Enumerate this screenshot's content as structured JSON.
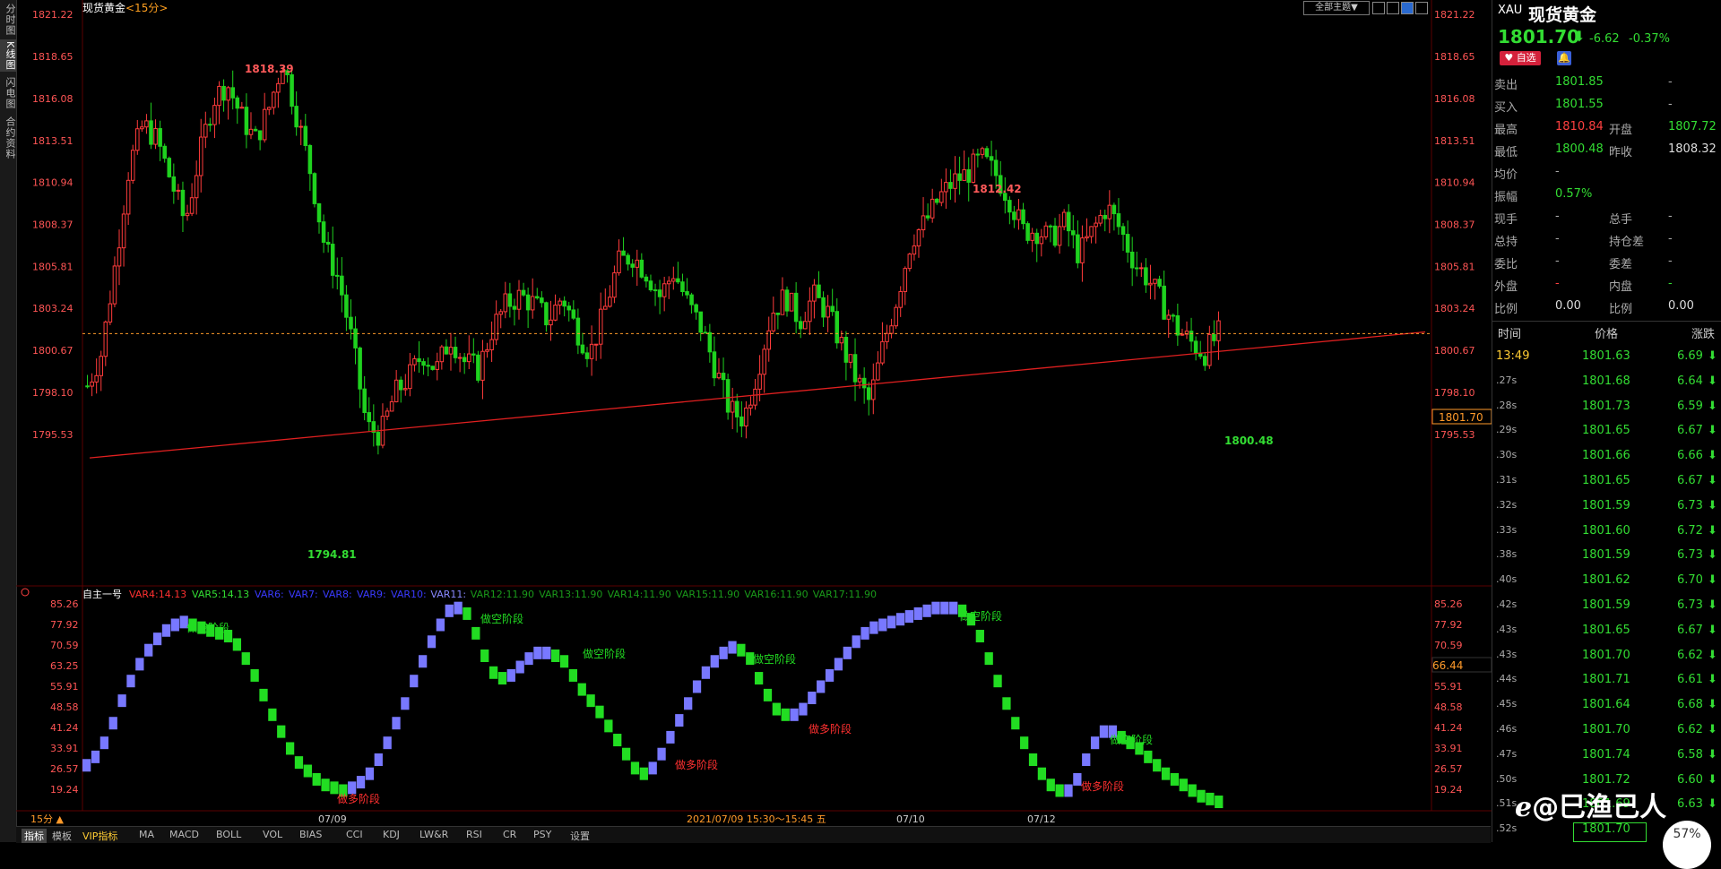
{
  "left_tabs": [
    "分时图",
    "K线图",
    "闪电图",
    "合约资料"
  ],
  "chart_header": {
    "name": "现货黄金",
    "period": "<15分>"
  },
  "top_right_button": "全部主题▼",
  "price_axis_labels": [
    "1821.22",
    "1818.65",
    "1816.08",
    "1813.51",
    "1810.94",
    "1808.37",
    "1805.81",
    "1803.24",
    "1800.67",
    "1798.10",
    "1795.53"
  ],
  "price_axis_right_labels": [
    "1821.22",
    "1818.65",
    "1816.08",
    "1813.51",
    "1810.94",
    "1808.37",
    "1805.81",
    "1803.24",
    "1800.67",
    "1798.10",
    "1795.53"
  ],
  "current_price_tag": "1801.70",
  "annotations": {
    "high": "1818.39",
    "low": "1794.81",
    "peak2": "1812.42",
    "recent_low": "1800.48"
  },
  "indicator_header": {
    "name": "自主一号",
    "vars": [
      {
        "text": "VAR4:14.13",
        "color": "#ff3030"
      },
      {
        "text": "VAR5:14.13",
        "color": "#33dd33"
      },
      {
        "text": "VAR6:",
        "color": "#3a3aff"
      },
      {
        "text": "VAR7:",
        "color": "#3a3aff"
      },
      {
        "text": "VAR8:",
        "color": "#3a3aff"
      },
      {
        "text": "VAR9:",
        "color": "#3a3aff"
      },
      {
        "text": "VAR10:",
        "color": "#3a3aff"
      },
      {
        "text": "VAR11:",
        "color": "#8888ff"
      },
      {
        "text": "VAR12:11.90",
        "color": "#1a9a1a"
      },
      {
        "text": "VAR13:11.90",
        "color": "#1a9a1a"
      },
      {
        "text": "VAR14:11.90",
        "color": "#1a9a1a"
      },
      {
        "text": "VAR15:11.90",
        "color": "#1a9a1a"
      },
      {
        "text": "VAR16:11.90",
        "color": "#1a9a1a"
      },
      {
        "text": "VAR17:11.90",
        "color": "#1a9a1a"
      }
    ]
  },
  "indicator_axis_labels": [
    "85.26",
    "77.92",
    "70.59",
    "63.25",
    "55.91",
    "48.58",
    "41.24",
    "33.91",
    "26.57",
    "19.24"
  ],
  "indicator_current_tag": "66.44",
  "indicator_labels": {
    "bear": "做空阶段",
    "bull": "做多阶段"
  },
  "date_labels": [
    "07/09",
    "07/10",
    "07/12"
  ],
  "cursor_date": "2021/07/09 15:30～15:45 五",
  "period_selector": "15分 ▲",
  "bottom_tabs": [
    "指标",
    "模板",
    "VIP指标",
    "MA",
    "MACD",
    "BOLL",
    "VOL",
    "BIAS",
    "CCI",
    "KDJ",
    "LW&R",
    "RSI",
    "CR",
    "PSY",
    "设置"
  ],
  "quote": {
    "symbol": "XAU",
    "name": "现货黄金",
    "price": "1801.70",
    "change": "-6.62",
    "change_pct": "-0.37%",
    "watch_button": "自选",
    "rows": [
      {
        "l1": "卖出",
        "v1": "1801.85",
        "l2": "",
        "v2": "-",
        "c1": "#33dd33",
        "c2": "#aaa"
      },
      {
        "l1": "买入",
        "v1": "1801.55",
        "l2": "",
        "v2": "-",
        "c1": "#33dd33",
        "c2": "#aaa"
      },
      {
        "l1": "最高",
        "v1": "1810.84",
        "l2": "开盘",
        "v2": "1807.72",
        "c1": "#ff4040",
        "c2": "#33dd33"
      },
      {
        "l1": "最低",
        "v1": "1800.48",
        "l2": "昨收",
        "v2": "1808.32",
        "c1": "#33dd33",
        "c2": "#dddddd"
      },
      {
        "l1": "均价",
        "v1": "-",
        "l2": "",
        "v2": "",
        "c1": "#aaa",
        "c2": "#aaa"
      },
      {
        "l1": "振幅",
        "v1": "0.57%",
        "l2": "",
        "v2": "",
        "c1": "#33dd33",
        "c2": "#aaa"
      },
      {
        "l1": "现手",
        "v1": "-",
        "l2": "总手",
        "v2": "-",
        "c1": "#aaa",
        "c2": "#aaa"
      },
      {
        "l1": "总持",
        "v1": "-",
        "l2": "持仓差",
        "v2": "-",
        "c1": "#aaa",
        "c2": "#aaa"
      },
      {
        "l1": "委比",
        "v1": "-",
        "l2": "委差",
        "v2": "-",
        "c1": "#aaa",
        "c2": "#aaa"
      },
      {
        "l1": "外盘",
        "v1": "-",
        "l2": "内盘",
        "v2": "-",
        "c1": "#ff4040",
        "c2": "#33dd33"
      },
      {
        "l1": "比例",
        "v1": "0.00",
        "l2": "比例",
        "v2": "0.00",
        "c1": "#dddddd",
        "c2": "#dddddd"
      }
    ],
    "ticks_header": [
      "时间",
      "价格",
      "涨跌"
    ],
    "ticks": [
      {
        "t": "13:49",
        "p": "1801.63",
        "d": "6.69"
      },
      {
        "t": ".27s",
        "p": "1801.68",
        "d": "6.64"
      },
      {
        "t": ".28s",
        "p": "1801.73",
        "d": "6.59"
      },
      {
        "t": ".29s",
        "p": "1801.65",
        "d": "6.67"
      },
      {
        "t": ".30s",
        "p": "1801.66",
        "d": "6.66"
      },
      {
        "t": ".31s",
        "p": "1801.65",
        "d": "6.67"
      },
      {
        "t": ".32s",
        "p": "1801.59",
        "d": "6.73"
      },
      {
        "t": ".33s",
        "p": "1801.60",
        "d": "6.72"
      },
      {
        "t": ".38s",
        "p": "1801.59",
        "d": "6.73"
      },
      {
        "t": ".40s",
        "p": "1801.62",
        "d": "6.70"
      },
      {
        "t": ".42s",
        "p": "1801.59",
        "d": "6.73"
      },
      {
        "t": ".43s",
        "p": "1801.65",
        "d": "6.67"
      },
      {
        "t": ".43s",
        "p": "1801.70",
        "d": "6.62"
      },
      {
        "t": ".44s",
        "p": "1801.71",
        "d": "6.61"
      },
      {
        "t": ".45s",
        "p": "1801.64",
        "d": "6.68"
      },
      {
        "t": ".46s",
        "p": "1801.70",
        "d": "6.62"
      },
      {
        "t": ".47s",
        "p": "1801.74",
        "d": "6.58"
      },
      {
        "t": ".50s",
        "p": "1801.72",
        "d": "6.60"
      },
      {
        "t": ".51s",
        "p": "1801.69",
        "d": "6.63"
      },
      {
        "t": ".52s",
        "p": "1801.70",
        "d": ""
      }
    ],
    "down_arrow": "⬇"
  },
  "watermark": "@巳渔己人",
  "progress_badge": "57%",
  "progress_level": 0.57,
  "colors": {
    "up": "#ff3b3b",
    "down": "#1fd21f",
    "bg": "#000000",
    "trend": "#e02020",
    "current_line": "#ff9a2a",
    "bull_bar": "#7878ff",
    "bear_bar": "#22dd22"
  },
  "chart_data": [
    {
      "type": "candlestick",
      "title": "现货黄金 <15分>",
      "ylim": [
        1794.5,
        1822
      ],
      "yticks": [
        1821.22,
        1818.65,
        1816.08,
        1813.51,
        1810.94,
        1808.37,
        1805.81,
        1803.24,
        1800.67,
        1798.1,
        1795.53
      ],
      "x_labels": [
        "07/09",
        "07/10",
        "07/12"
      ],
      "close_path": [
        1798.5,
        1800.5,
        1806,
        1812,
        1814.5,
        1813.5,
        1811,
        1808.5,
        1812.5,
        1816,
        1817,
        1815,
        1813.5,
        1815.5,
        1818.39,
        1815,
        1811.5,
        1807,
        1805,
        1801,
        1796,
        1795.5,
        1798,
        1799,
        1800.5,
        1799.5,
        1801.5,
        1800,
        1799.5,
        1802,
        1803.5,
        1804,
        1803.5,
        1802.5,
        1804,
        1802,
        1800.5,
        1803,
        1806,
        1806.5,
        1805.5,
        1804,
        1805.5,
        1803.5,
        1802,
        1799.5,
        1797,
        1796.5,
        1799.5,
        1803,
        1804,
        1802.5,
        1804,
        1803,
        1801,
        1799,
        1797.5,
        1801,
        1804,
        1807.5,
        1808.5,
        1810,
        1811,
        1811.5,
        1812.42,
        1811.5,
        1810,
        1808,
        1808,
        1807.5,
        1808.5,
        1806.5,
        1808,
        1809.5,
        1808,
        1806,
        1805,
        1803.5,
        1802,
        1801.2,
        1800.48,
        1801.7
      ],
      "trendline": {
        "from": 1794.1,
        "to": 1801.8
      },
      "annotations": [
        {
          "label": "1818.39"
        },
        {
          "label": "1794.81"
        },
        {
          "label": "1812.42"
        },
        {
          "label": "1800.48"
        }
      ],
      "current_price": 1801.7
    },
    {
      "type": "bar",
      "title": "自主一号",
      "ylim": [
        12,
        88
      ],
      "yticks": [
        85.26,
        77.92,
        70.59,
        63.25,
        55.91,
        48.58,
        41.24,
        33.91,
        26.57,
        19.24
      ],
      "series": [
        {
          "values": [
            30,
            33,
            38,
            45,
            53,
            60,
            66,
            71,
            75,
            78,
            80,
            81,
            80,
            79,
            78,
            77,
            76,
            73,
            68,
            62,
            55,
            48,
            42,
            36,
            31,
            28,
            25,
            23,
            22,
            21,
            22,
            24,
            27,
            32,
            38,
            45,
            52,
            60,
            67,
            74,
            80,
            85,
            86,
            84,
            77,
            69,
            63,
            61,
            62,
            65,
            68,
            70,
            70,
            69,
            67,
            62,
            57,
            53,
            49,
            44,
            39,
            34,
            29,
            27,
            29,
            34,
            40,
            46,
            52,
            58,
            63,
            67,
            70,
            72,
            71,
            68,
            61,
            55,
            50,
            48,
            48,
            50,
            54,
            58,
            62,
            66,
            70,
            74,
            77,
            79,
            80,
            81,
            82,
            83,
            84,
            85,
            86,
            86,
            86,
            85,
            82,
            76,
            68,
            60,
            52,
            45,
            38,
            32,
            27,
            23,
            21,
            21,
            25,
            32,
            38,
            42,
            42,
            40,
            38,
            36,
            33,
            30,
            27,
            25,
            23,
            21,
            19,
            18,
            17
          ]
        }
      ],
      "current_value": 66.44
    }
  ]
}
